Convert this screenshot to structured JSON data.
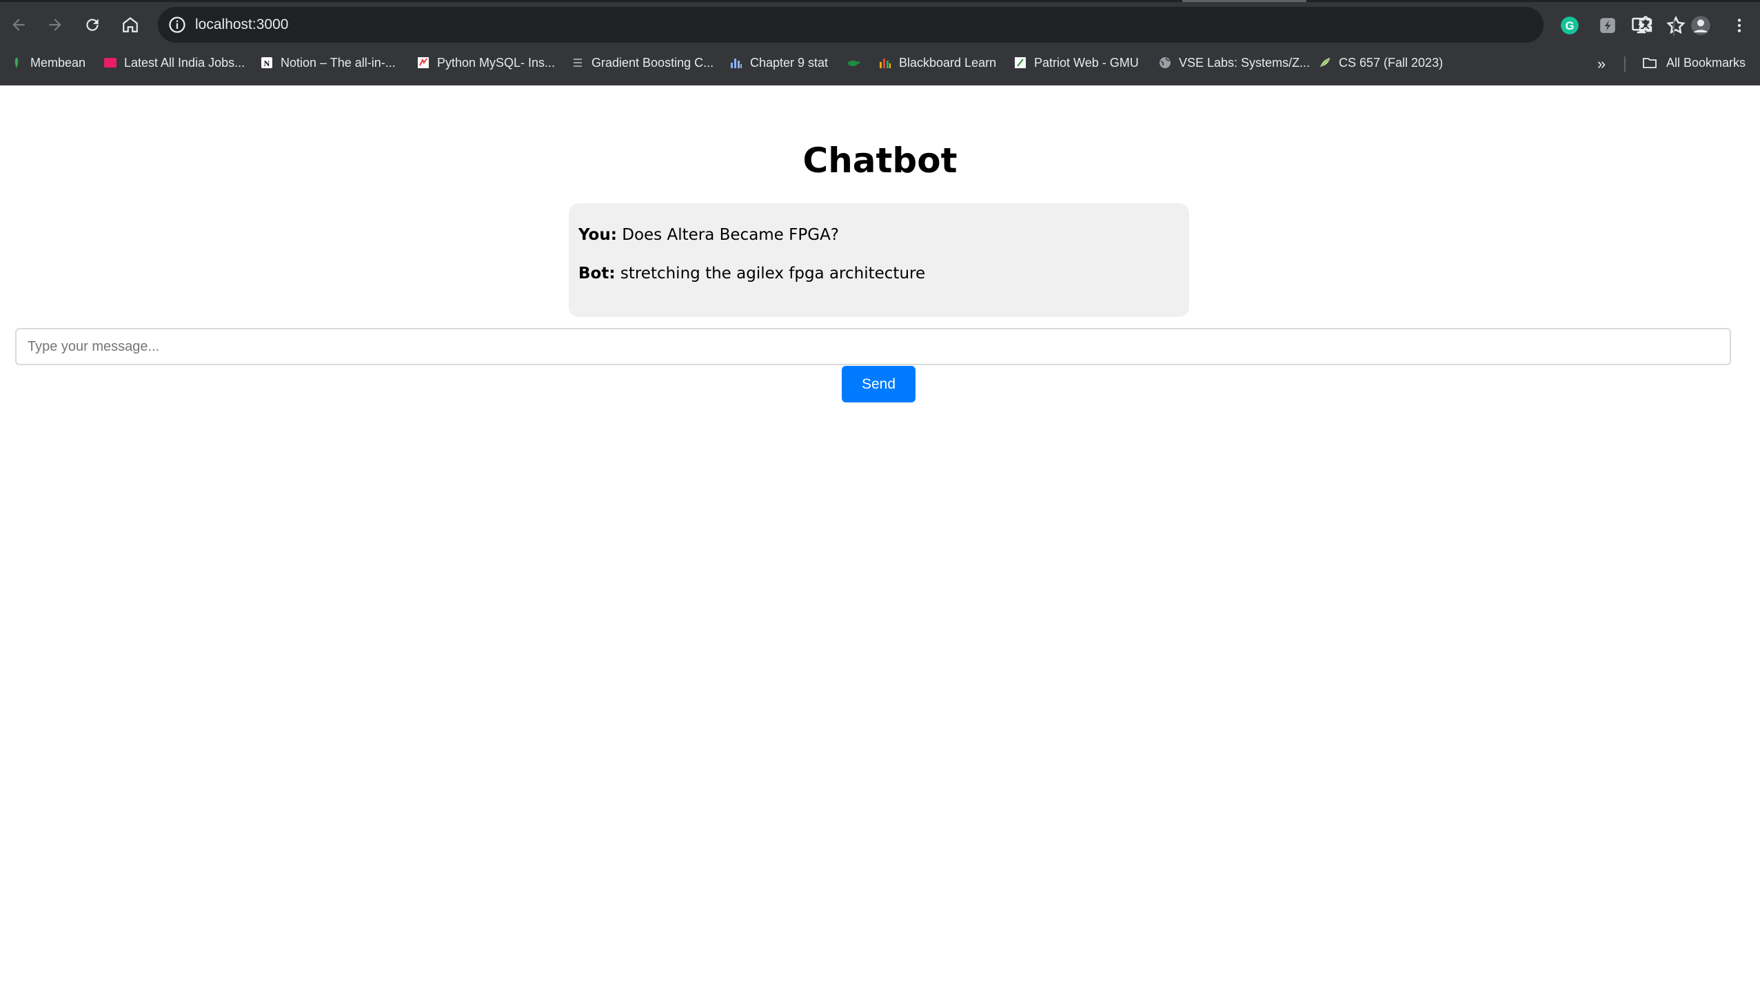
{
  "browser": {
    "url": "localhost:3000",
    "bookmarks": [
      {
        "label": "Membean",
        "icon": "membean-icon",
        "color": "#3aa757"
      },
      {
        "label": "Latest All India Jobs...",
        "icon": "jobs-icon",
        "color": "#e91e63"
      },
      {
        "label": "Notion – The all-in-...",
        "icon": "notion-icon",
        "color": "#ffffff"
      },
      {
        "label": "Python MySQL- Ins...",
        "icon": "python-icon",
        "color": "#ffffff"
      },
      {
        "label": "Gradient Boosting C...",
        "icon": "gradient-icon",
        "color": "#9aa0a6"
      },
      {
        "label": "Chapter 9 stat",
        "icon": "bar-chart-icon",
        "color": "#8ab4f8"
      },
      {
        "label": "",
        "icon": "turtle-icon",
        "color": "#1e8e3e"
      },
      {
        "label": "Blackboard Learn",
        "icon": "blackboard-icon",
        "color": "#f9ab00"
      },
      {
        "label": "Patriot Web - GMU",
        "icon": "patriot-icon",
        "color": "#ffffff"
      },
      {
        "label": "VSE Labs: Systems/Z...",
        "icon": "globe-icon",
        "color": "#9aa0a6"
      },
      {
        "label": "CS 657 (Fall 2023)",
        "icon": "canvas-icon",
        "color": "#c5e1a5"
      }
    ],
    "all_bookmarks_label": "All Bookmarks"
  },
  "page": {
    "title": "Chatbot",
    "messages": [
      {
        "sender": "You:",
        "text": " Does Altera Became FPGA?"
      },
      {
        "sender": "Bot:",
        "text": " stretching the agilex fpga architecture"
      }
    ],
    "input_placeholder": "Type your message...",
    "input_value": "",
    "send_label": "Send",
    "colors": {
      "send_button": "#007bff",
      "chat_background": "#f0f0f0"
    }
  }
}
